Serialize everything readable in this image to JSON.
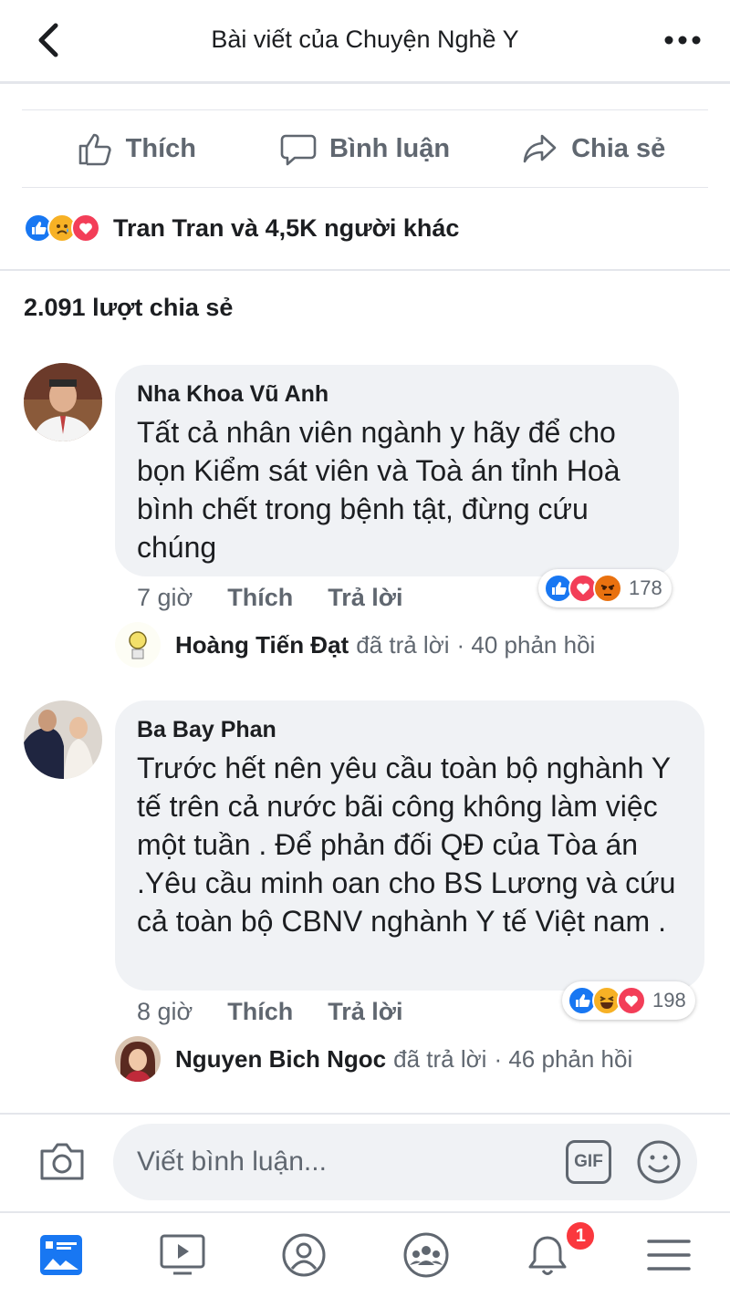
{
  "header": {
    "title": "Bài viết của Chuyện Nghề Y"
  },
  "actions": {
    "like": "Thích",
    "comment": "Bình luận",
    "share": "Chia sẻ"
  },
  "reactions_summary": {
    "text": "Tran Tran và 4,5K người khác",
    "icons": [
      "like-icon",
      "sad-icon",
      "love-icon"
    ]
  },
  "shares": {
    "text": "2.091 lượt chia sẻ"
  },
  "comments": [
    {
      "author": "Nha Khoa Vũ Anh",
      "text": "Tất cả nhân viên ngành y hãy để cho bọn Kiểm sát viên và Toà án tỉnh Hoà bình chết trong bệnh tật, đừng cứu chúng",
      "time": "7 giờ",
      "like_label": "Thích",
      "reply_label": "Trả lời",
      "reaction_count": "178",
      "reaction_icons": [
        "like-icon",
        "love-icon",
        "angry-icon"
      ],
      "reply": {
        "author": "Hoàng Tiến Đạt",
        "action": "đã trả lời",
        "count": "· 40 phản hồi"
      }
    },
    {
      "author": "Ba Bay Phan",
      "text": "Trước hết nên yêu cầu toàn bộ nghành Y tế trên cả nước bãi công  không làm việc một tuần . Để phản đối QĐ của Tòa án .Yêu cầu minh oan cho BS Lương và cứu cả toàn bộ CBNV nghành Y tế Việt nam .",
      "time": "8 giờ",
      "like_label": "Thích",
      "reply_label": "Trả lời",
      "reaction_count": "198",
      "reaction_icons": [
        "like-icon",
        "haha-icon",
        "love-icon"
      ],
      "reply": {
        "author": "Nguyen Bich Ngoc",
        "action": "đã trả lời",
        "count": "· 46 phản hồi"
      }
    }
  ],
  "composer": {
    "placeholder": "Viết bình luận...",
    "gif_label": "GIF"
  },
  "nav": {
    "notifications_badge": "1"
  },
  "colors": {
    "like_blue": "#1877f2",
    "love_red": "#f33e58",
    "yellow": "#f7b125",
    "text_gray": "#606770"
  }
}
